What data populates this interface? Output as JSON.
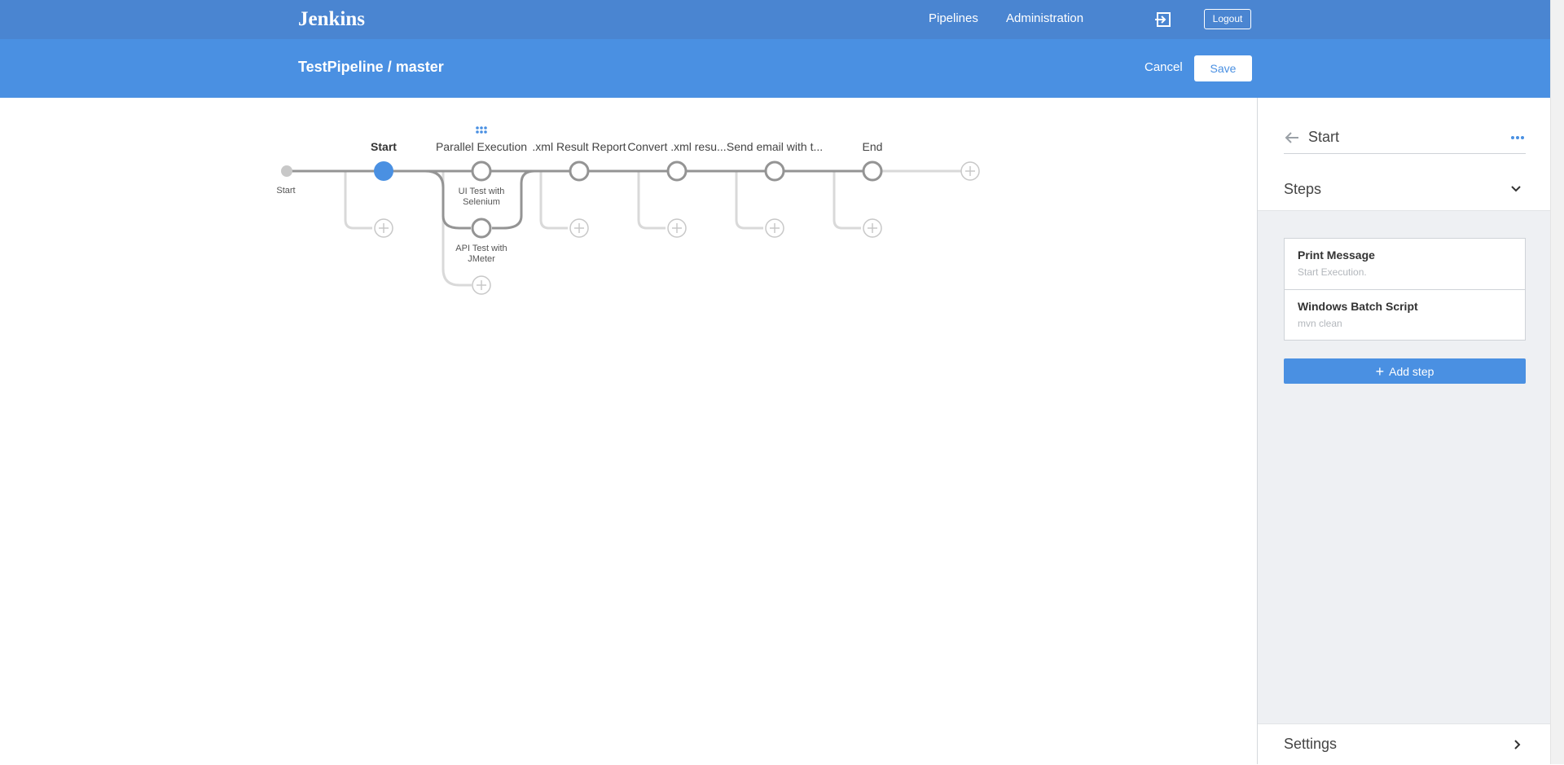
{
  "topbar": {
    "logo": "Jenkins",
    "nav": [
      "Pipelines",
      "Administration"
    ],
    "logout_label": "Logout"
  },
  "subheader": {
    "title": "TestPipeline / master",
    "cancel_label": "Cancel",
    "save_label": "Save"
  },
  "pipeline": {
    "start_label": "Start",
    "stages": [
      {
        "name": "Start",
        "selected": true
      },
      {
        "name": "Parallel Execution",
        "branches": [
          "UI Test with Selenium",
          "API Test with JMeter"
        ]
      },
      {
        "name": ".xml Result Report"
      },
      {
        "name": "Convert .xml resu..."
      },
      {
        "name": "Send email with t..."
      },
      {
        "name": "End"
      }
    ],
    "branch_1_line1": "UI Test with",
    "branch_1_line2": "Selenium",
    "branch_2_line1": "API Test with",
    "branch_2_line2": "JMeter"
  },
  "panel": {
    "title": "Start",
    "steps_heading": "Steps",
    "steps": [
      {
        "name": "Print Message",
        "desc": "Start Execution."
      },
      {
        "name": "Windows Batch Script",
        "desc": "mvn clean"
      }
    ],
    "add_step_label": "Add step",
    "settings_label": "Settings"
  },
  "colors": {
    "topbar": "#4a85d1",
    "subheader": "#4a90e2",
    "accent": "#4a90e2",
    "graph_line": "#949494",
    "graph_placeholder": "#d9d9d9"
  }
}
